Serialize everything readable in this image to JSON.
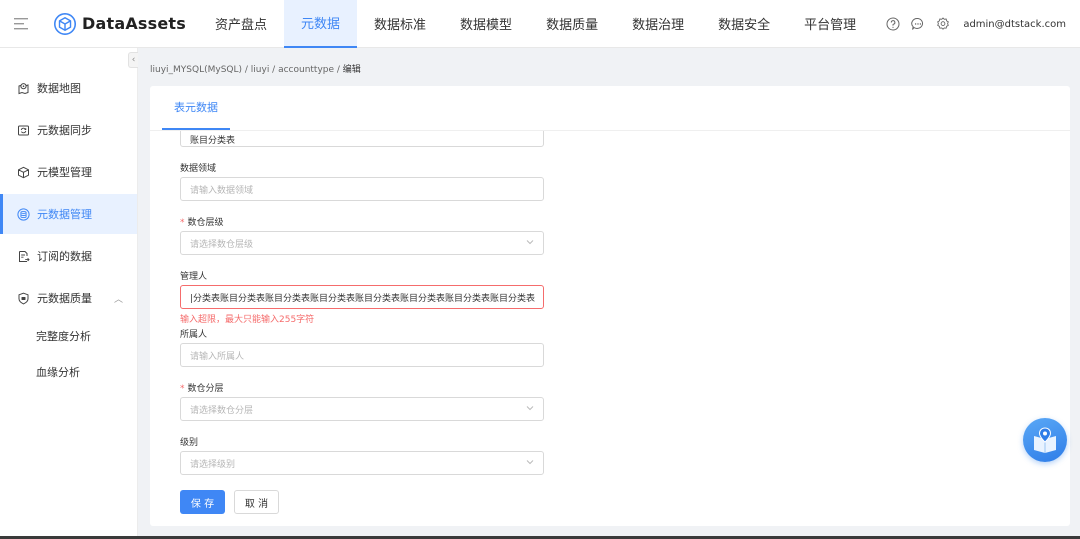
{
  "colors": {
    "accent": "#3f87f5",
    "error": "#f56c6c",
    "active_bg": "#e8f1ff"
  },
  "header": {
    "app_name": "DataAssets",
    "nav": [
      {
        "label": "资产盘点",
        "active": false
      },
      {
        "label": "元数据",
        "active": true
      },
      {
        "label": "数据标准",
        "active": false
      },
      {
        "label": "数据模型",
        "active": false
      },
      {
        "label": "数据质量",
        "active": false
      },
      {
        "label": "数据治理",
        "active": false
      },
      {
        "label": "数据安全",
        "active": false
      },
      {
        "label": "平台管理",
        "active": false
      }
    ],
    "icons": [
      "help-icon",
      "message-icon",
      "settings-icon"
    ],
    "user": "admin@dtstack.com"
  },
  "sidebar": {
    "collapse_glyph": "‹",
    "items": [
      {
        "label": "数据地图",
        "icon": "map-icon",
        "active": false
      },
      {
        "label": "元数据同步",
        "icon": "sync-icon",
        "active": false
      },
      {
        "label": "元模型管理",
        "icon": "cube-icon",
        "active": false
      },
      {
        "label": "元数据管理",
        "icon": "database-icon",
        "active": true
      },
      {
        "label": "订阅的数据",
        "icon": "subscribe-icon",
        "active": false
      },
      {
        "label": "元数据质量",
        "icon": "shield-icon",
        "active": false,
        "expanded": true
      }
    ],
    "sub_items": [
      {
        "label": "完整度分析"
      },
      {
        "label": "血缘分析"
      }
    ]
  },
  "breadcrumb": {
    "path": "liuyi_MYSQL(MySQL) / liuyi / accounttype / ",
    "current": "编辑"
  },
  "card": {
    "tab": "表元数据",
    "form": {
      "top_value": "账目分类表",
      "data_domain": {
        "label": "数据领域",
        "placeholder": "请输入数据领域"
      },
      "dw_level": {
        "label": "数仓层级",
        "required": "*",
        "placeholder": "请选择数仓层级"
      },
      "manager": {
        "label": "管理人",
        "value": "|分类表账目分类表账目分类表账目分类表账目分类表账目分类表账目分类表账目分类表",
        "error": "输入超限，最大只能输入255字符"
      },
      "owner": {
        "label": "所属人",
        "placeholder": "请输入所属人"
      },
      "dw_layer": {
        "label": "数仓分层",
        "required": "*",
        "placeholder": "请选择数仓分层"
      },
      "grade": {
        "label": "级别",
        "placeholder": "请选择级别"
      }
    },
    "buttons": {
      "save": "保 存",
      "cancel": "取 消"
    }
  }
}
